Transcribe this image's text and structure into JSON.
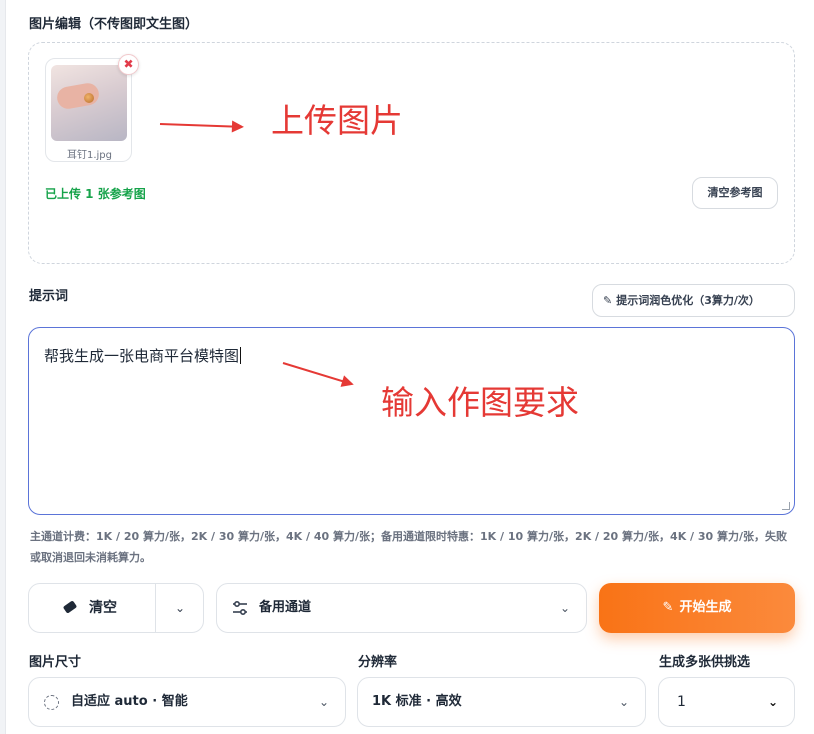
{
  "image_edit": {
    "title": "图片编辑（不传图即文生图）",
    "files": [
      {
        "name": "耳钉1.jpg"
      }
    ],
    "remove_icon": "close-icon",
    "status": "已上传 1 张参考图",
    "clear_refs_label": "清空参考图"
  },
  "annotations": {
    "upload": "上传图片",
    "prompt": "输入作图要求"
  },
  "prompt": {
    "title": "提示词",
    "optimize_label": "提示词润色优化（3算力/次）",
    "value": "帮我生成一张电商平台模特图"
  },
  "pricing_note": "主通道计费：1K / 20 算力/张，2K / 30 算力/张，4K / 40 算力/张；备用通道限时特惠：1K / 10 算力/张，2K / 20 算力/张，4K / 30 算力/张，失败或取消退回未消耗算力。",
  "actions": {
    "clear_label": "清空",
    "channel_label": "备用通道",
    "start_label": "开始生成"
  },
  "options": {
    "size_label": "图片尺寸",
    "size_value": "自适应 auto · 智能",
    "resolution_label": "分辨率",
    "resolution_value": "1K 标准 · 高效",
    "count_label": "生成多张供挑选",
    "count_value": "1"
  },
  "colors": {
    "accent_orange": "#f97316",
    "success_green": "#16a34a",
    "annotation_red": "#e53935",
    "focus_blue": "#5b74d8"
  }
}
